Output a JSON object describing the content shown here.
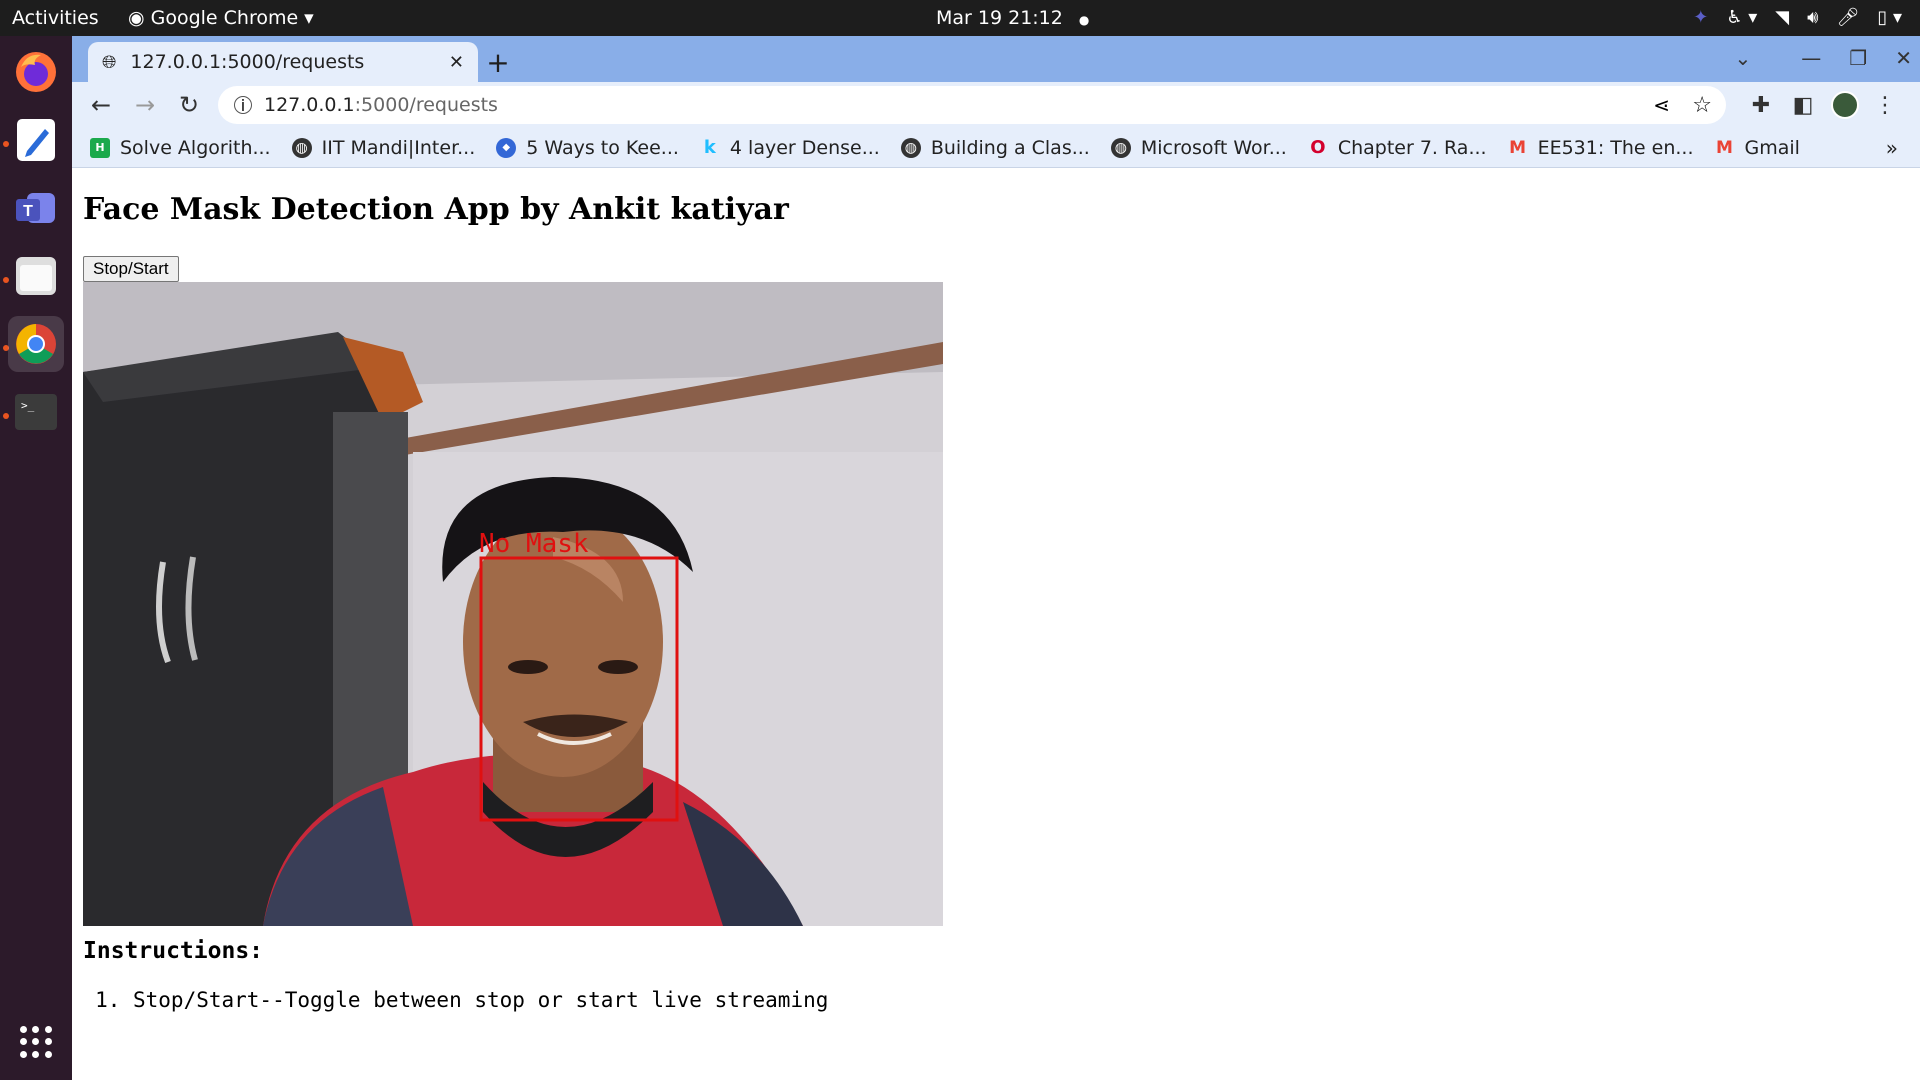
{
  "topbar": {
    "activities": "Activities",
    "app_name": "Google Chrome",
    "clock": "Mar 19  21:12"
  },
  "dock": {
    "apps": [
      "firefox-icon",
      "text-editor-icon",
      "teams-icon",
      "files-icon",
      "chrome-icon",
      "terminal-icon"
    ]
  },
  "browser": {
    "tab_title": "127.0.0.1:5000/requests",
    "url_host": "127.0.0.1",
    "url_path": ":5000/requests",
    "bookmarks": [
      {
        "label": "Solve Algorith...",
        "icon": "hackerrank-icon"
      },
      {
        "label": "IIT Mandi|Inter...",
        "icon": "globe-icon"
      },
      {
        "label": "5 Ways to Kee...",
        "icon": "shield-icon"
      },
      {
        "label": "4 layer Dense...",
        "icon": "kaggle-icon"
      },
      {
        "label": "Building a Clas...",
        "icon": "globe-icon"
      },
      {
        "label": "Microsoft Wor...",
        "icon": "globe-icon"
      },
      {
        "label": "Chapter 7. Ra...",
        "icon": "oreilly-icon"
      },
      {
        "label": "EE531: The en...",
        "icon": "gmail-icon"
      },
      {
        "label": "Gmail",
        "icon": "gmail-icon"
      }
    ],
    "more_bookmarks": "»"
  },
  "page": {
    "heading": "Face Mask Detection App by Ankit katiyar",
    "toggle_button": "Stop/Start",
    "video": {
      "detection_label": "No Mask",
      "box_color": "#e01010"
    },
    "instructions_heading": "Instructions:",
    "instructions": [
      "Stop/Start--Toggle between stop or start live streaming"
    ]
  }
}
